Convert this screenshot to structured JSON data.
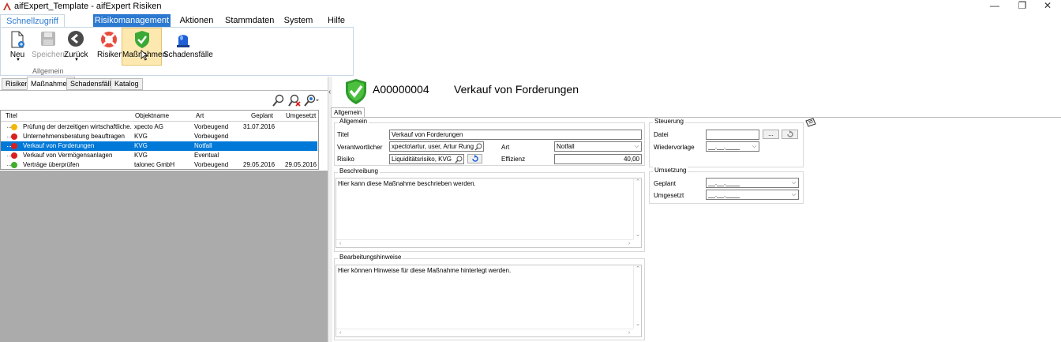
{
  "window": {
    "title": "aifExpert_Template - aifExpert Risiken",
    "minimize": "—",
    "maximize": "❐",
    "close": "✕"
  },
  "ribbon": {
    "tabs": [
      "Schnellzugriff",
      "Risikomanagement",
      "Aktionen",
      "Stammdaten",
      "System",
      "Hilfe"
    ],
    "active_tab": "Risikomanagement",
    "quick_group_label": "Allgemein",
    "buttons": {
      "neu": "Neu",
      "speichern": "Speichern",
      "zurueck": "Zurück",
      "risiken": "Risiken",
      "massnahmen": "Maßnahmen",
      "schadensfaelle": "Schadensfälle"
    }
  },
  "left_tabs": [
    "Risiken",
    "Maßnahmen",
    "Schadensfälle",
    "Katalog"
  ],
  "grid": {
    "columns": [
      "Titel",
      "Objektname",
      "Art",
      "Geplant",
      "Umgesetzt"
    ],
    "rows": [
      {
        "status": "yellow",
        "titel": "Prüfung der derzeitigen wirtschaftliche...",
        "objekt": "xpecto AG",
        "art": "Vorbeugend",
        "geplant": "31.07.2016",
        "umgesetzt": ""
      },
      {
        "status": "red",
        "titel": "Unternehmensberatung beauftragen",
        "objekt": "KVG",
        "art": "Vorbeugend",
        "geplant": "",
        "umgesetzt": ""
      },
      {
        "status": "red",
        "titel": "Verkauf von Forderungen",
        "objekt": "KVG",
        "art": "Notfall",
        "geplant": "",
        "umgesetzt": ""
      },
      {
        "status": "red",
        "titel": "Verkauf von Vermögensanlagen",
        "objekt": "KVG",
        "art": "Eventual",
        "geplant": "",
        "umgesetzt": ""
      },
      {
        "status": "green",
        "titel": "Verträge überprüfen",
        "objekt": "talonec GmbH",
        "art": "Vorbeugend",
        "geplant": "29.05.2016",
        "umgesetzt": "29.05.2016"
      }
    ]
  },
  "colors": {
    "yellow": "#f2b705",
    "red": "#d92020",
    "green": "#3fae2a",
    "selection": "#0078d7",
    "ribbon_accent": "#2b79d0"
  },
  "header": {
    "id": "A00000004",
    "name": "Verkauf von Forderungen"
  },
  "detail_tab": "Allgemein",
  "allgemein": {
    "group": "Allgemein",
    "titel_label": "Titel",
    "titel_value": "Verkauf von Forderungen",
    "verantwortlicher_label": "Verantwortlicher",
    "verantwortlicher_value": "xpecto\\artur, user, Artur Rung",
    "risiko_label": "Risiko",
    "risiko_value": "Liquiditätsrisiko, KVG",
    "art_label": "Art",
    "art_value": "Notfall",
    "effizienz_label": "Effizienz",
    "effizienz_value": "40,00"
  },
  "steuerung": {
    "group": "Steuerung",
    "datei_label": "Datei",
    "datei_button": "...",
    "wiedervorlage_label": "Wiedervorlage",
    "wiedervorlage_value": "__.__.____"
  },
  "umsetzung": {
    "group": "Umsetzung",
    "geplant_label": "Geplant",
    "geplant_value": "__.__.____",
    "umgesetzt_label": "Umgesetzt",
    "umgesetzt_value": "__.__.____"
  },
  "beschreibung": {
    "group": "Beschreibung",
    "text": "Hier kann diese Maßnahme beschrieben werden."
  },
  "hinweise": {
    "group": "Bearbeitungshinweise",
    "text": "Hier können Hinweise für diese Maßnahme hinterlegt werden."
  },
  "splitter_arrow": "‹"
}
